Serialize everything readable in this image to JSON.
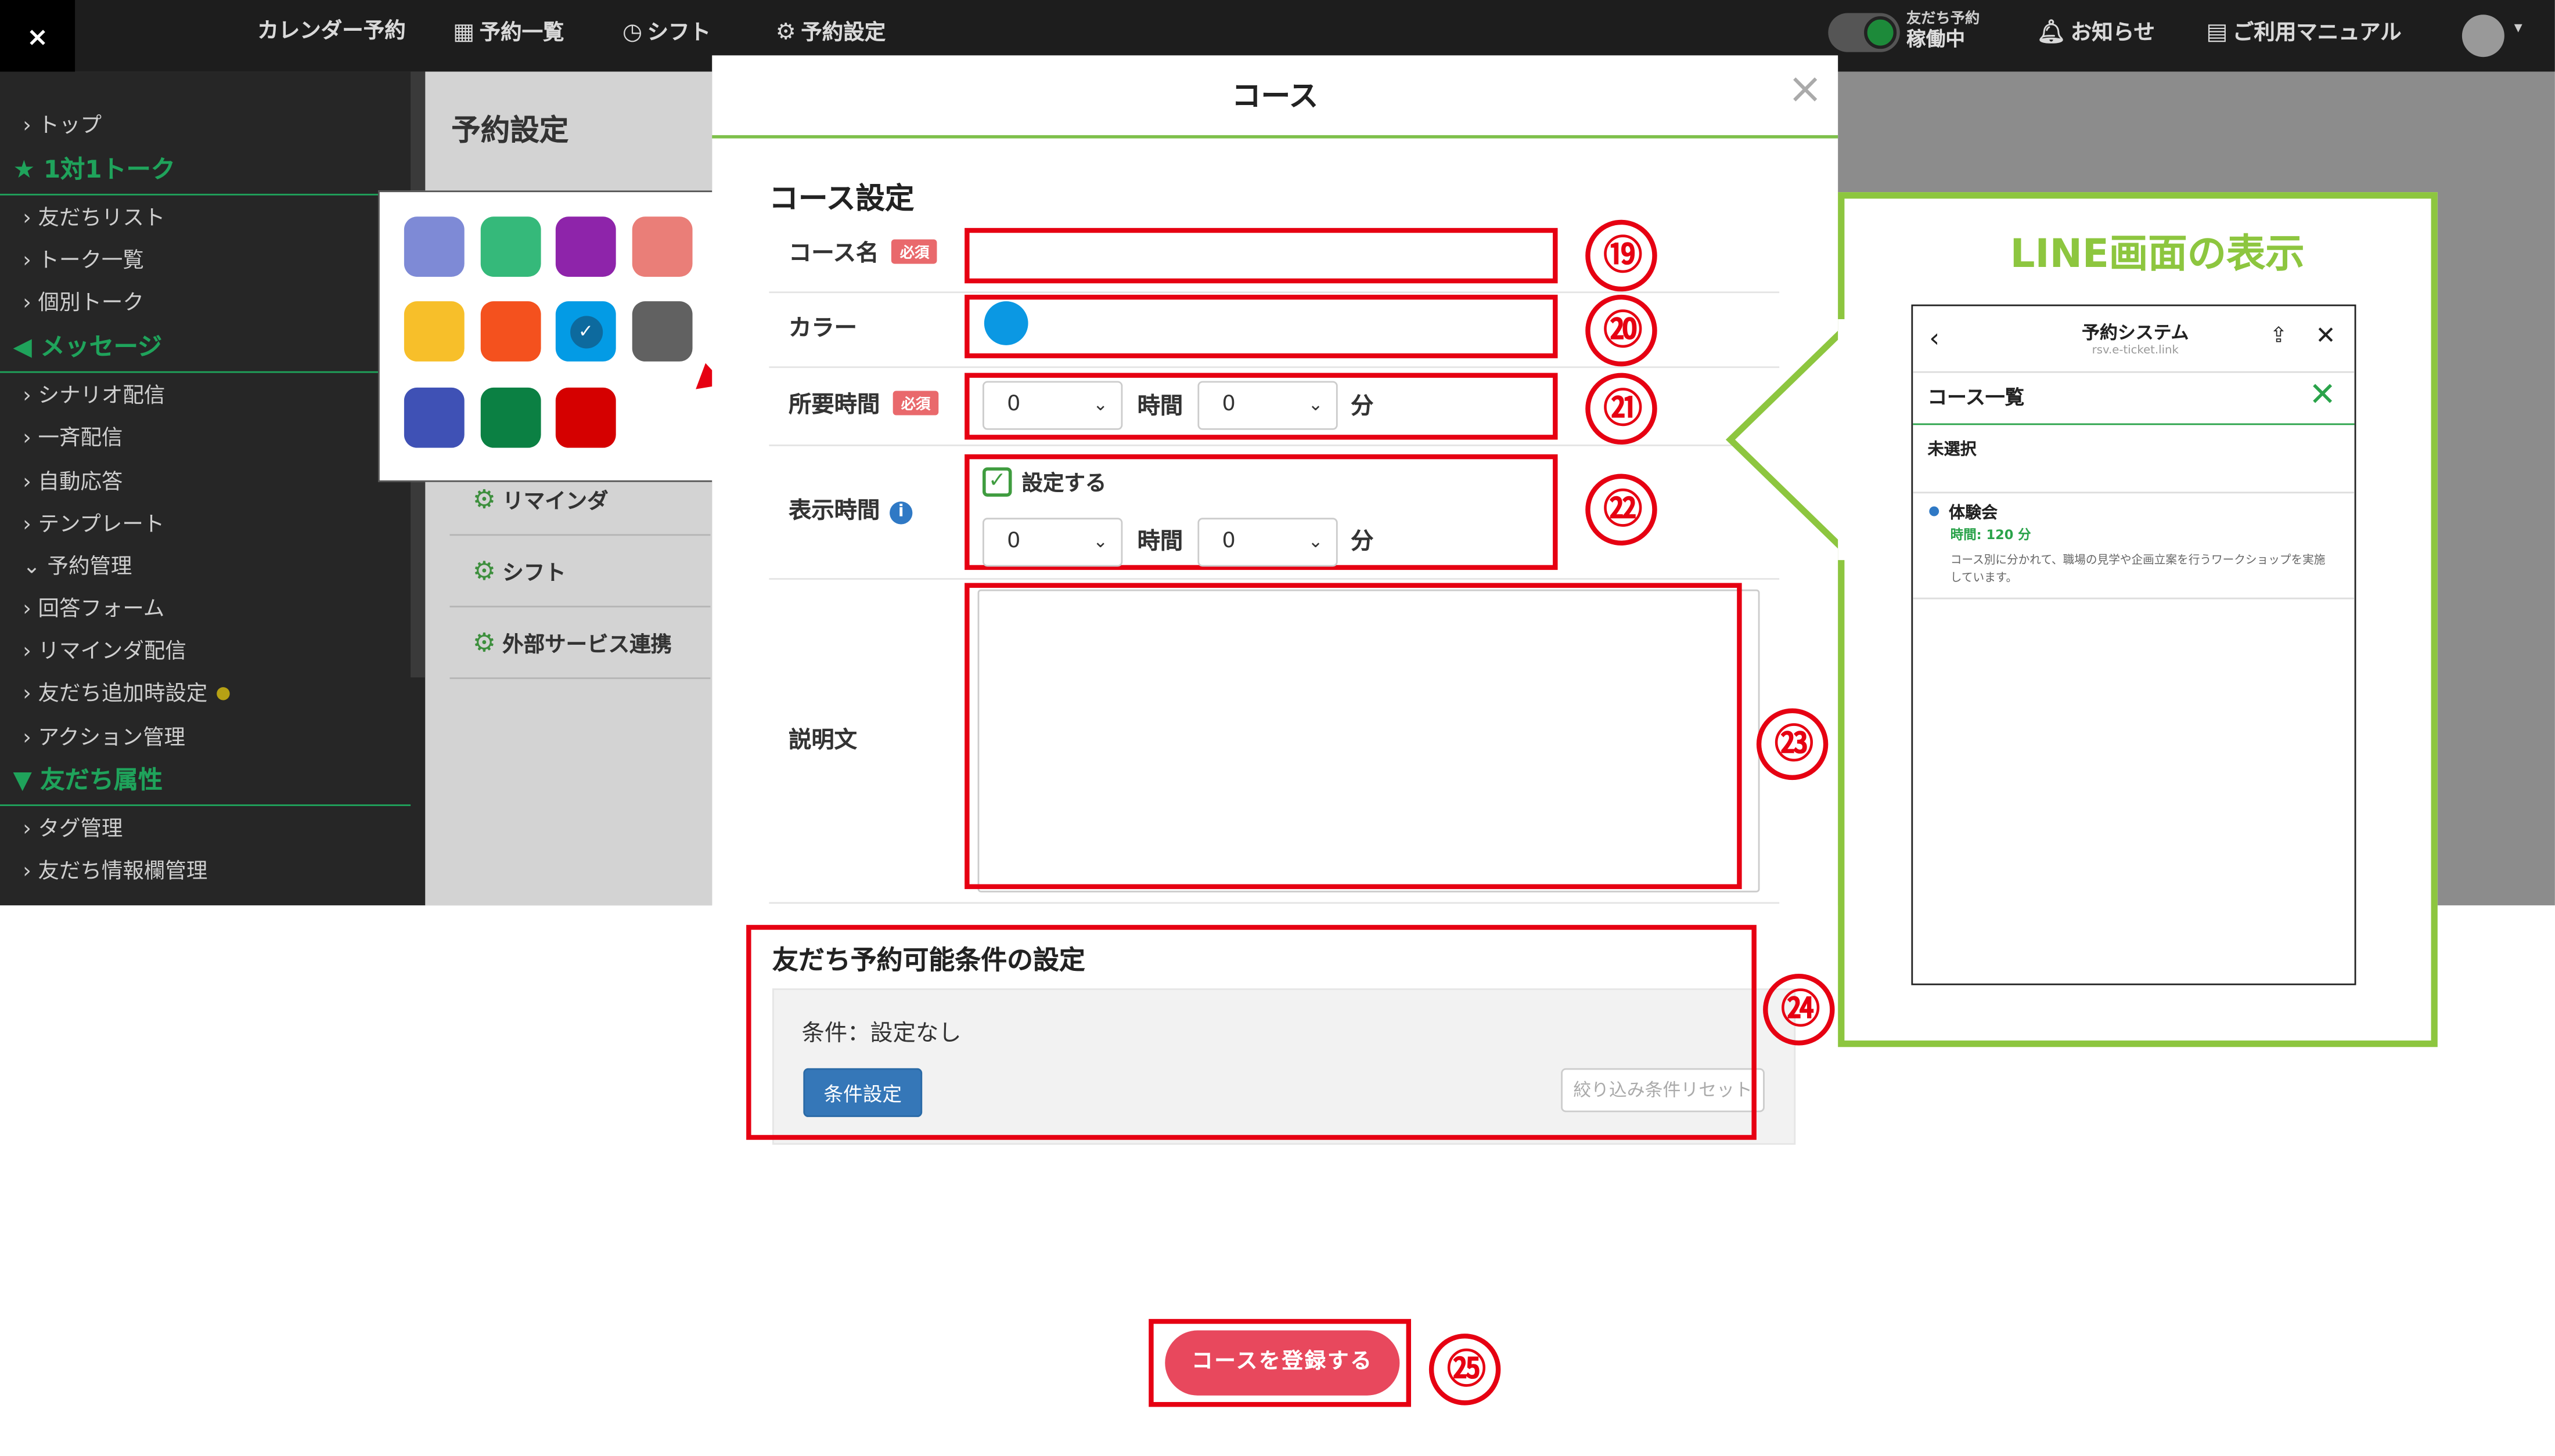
{
  "topbar": {
    "close": "×",
    "nav": [
      {
        "label": "カレンダー予約",
        "icon": ""
      },
      {
        "label": "予約一覧",
        "icon": "calendar-icon"
      },
      {
        "label": "シフト",
        "icon": "clock-icon"
      },
      {
        "label": "予約設定",
        "icon": "gear-icon"
      }
    ],
    "toggle_top": "友だち予約",
    "toggle_status": "稼働中",
    "notice": "お知らせ",
    "manual": "ご利用マニュアル"
  },
  "sidebar": {
    "items": [
      {
        "type": "item",
        "label": "トップ"
      },
      {
        "type": "header",
        "label": "1対1トーク",
        "icon": "star-icon"
      },
      {
        "type": "item",
        "label": "友だちリスト"
      },
      {
        "type": "item",
        "label": "トーク一覧"
      },
      {
        "type": "item",
        "label": "個別トーク"
      },
      {
        "type": "header",
        "label": "メッセージ",
        "icon": "megaphone-icon"
      },
      {
        "type": "item",
        "label": "シナリオ配信"
      },
      {
        "type": "item",
        "label": "一斉配信"
      },
      {
        "type": "item",
        "label": "自動応答"
      },
      {
        "type": "item",
        "label": "テンプレート"
      },
      {
        "type": "item",
        "label": "予約管理",
        "expanded": true
      },
      {
        "type": "item",
        "label": "回答フォーム"
      },
      {
        "type": "item",
        "label": "リマインダ配信"
      },
      {
        "type": "item",
        "label": "友だち追加時設定",
        "dot": true
      },
      {
        "type": "item",
        "label": "アクション管理"
      },
      {
        "type": "header",
        "label": "友だち属性",
        "icon": "filter-icon"
      },
      {
        "type": "item",
        "label": "タグ管理"
      },
      {
        "type": "item",
        "label": "友だち情報欄管理"
      }
    ]
  },
  "settings_card": {
    "title": "予約設定",
    "menu": [
      "リマインダ",
      "シフト",
      "外部サービス連携"
    ]
  },
  "palette": {
    "colors": [
      "#7e8ad6",
      "#35b97a",
      "#8e24aa",
      "#ea7e78",
      "#f7bf2a",
      "#f4511e",
      "#039be5",
      "#616161",
      "#3f51b5",
      "#0b8043",
      "#d50000"
    ],
    "selected_index": 6
  },
  "modal": {
    "title": "コース",
    "close": "×",
    "section_title": "コース設定",
    "fields": {
      "course_name": {
        "label": "コース名",
        "required": "必須",
        "value": ""
      },
      "color": {
        "label": "カラー",
        "value": "#0b98e3"
      },
      "duration": {
        "label": "所要時間",
        "required": "必須",
        "hours": "0",
        "hours_unit": "時間",
        "minutes": "0",
        "minutes_unit": "分"
      },
      "display_time": {
        "label": "表示時間",
        "info": "i",
        "checkbox_label": "設定する",
        "checked": true,
        "hours": "0",
        "hours_unit": "時間",
        "minutes": "0",
        "minutes_unit": "分"
      },
      "description": {
        "label": "説明文",
        "value": ""
      }
    },
    "conditions": {
      "title": "友だち予約可能条件の設定",
      "status": "条件：設定なし",
      "set_button": "条件設定",
      "reset_button": "絞り込み条件リセット"
    },
    "register_button": "コースを登録する"
  },
  "annotations": {
    "n19": "⑲",
    "n20": "⑳",
    "n21": "㉑",
    "n22": "㉒",
    "n23": "㉓",
    "n24": "㉔",
    "n25": "㉕"
  },
  "line_preview": {
    "title": "LINE画面の表示",
    "app_title": "予約システム",
    "app_url": "rsv.e-ticket.link",
    "list_header": "コース一覧",
    "unselected": "未選択",
    "item_name": "体験会",
    "item_time": "時間: 120 分",
    "item_desc": "コース別に分かれて、職場の見学や企画立案を行うワークショップを実施しています。"
  }
}
